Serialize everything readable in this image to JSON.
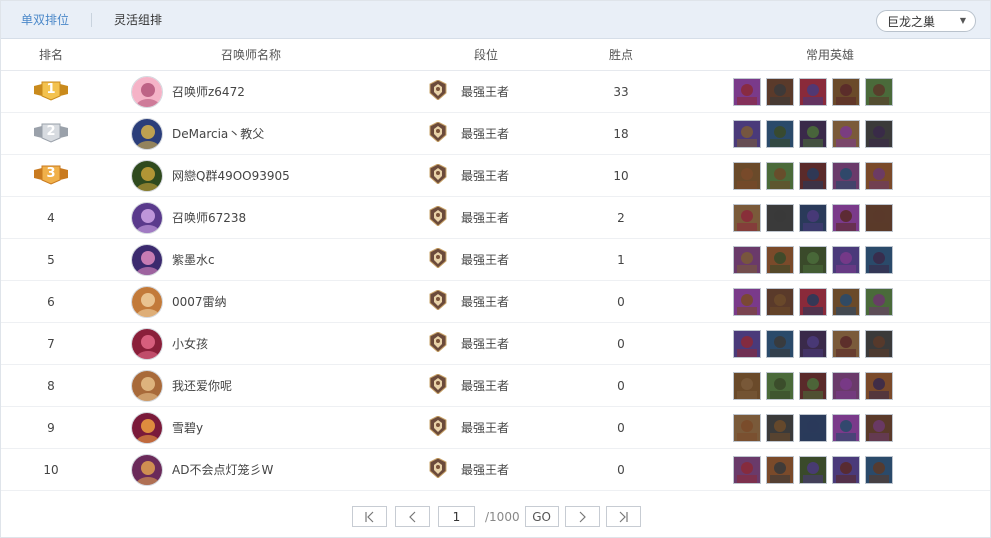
{
  "tabs": [
    {
      "label": "单双排位",
      "active": true
    },
    {
      "label": "灵活组排",
      "active": false
    }
  ],
  "server_select": {
    "value": "巨龙之巢"
  },
  "columns": {
    "rank": "排名",
    "name": "召唤师名称",
    "tier": "段位",
    "points": "胜点",
    "champions": "常用英雄"
  },
  "rows": [
    {
      "rank": "1",
      "medal": "gold",
      "name": "召唤师z6472",
      "tier": "最强王者",
      "points": "33"
    },
    {
      "rank": "2",
      "medal": "silver",
      "name": "DeMarcia丶教父",
      "tier": "最强王者",
      "points": "18"
    },
    {
      "rank": "3",
      "medal": "bronze",
      "name": "网戀Q群49OO93905",
      "tier": "最强王者",
      "points": "10"
    },
    {
      "rank": "4",
      "medal": "",
      "name": "召唤师67238",
      "tier": "最强王者",
      "points": "2"
    },
    {
      "rank": "5",
      "medal": "",
      "name": "紫墨水c",
      "tier": "最强王者",
      "points": "1"
    },
    {
      "rank": "6",
      "medal": "",
      "name": "0007雷纳",
      "tier": "最强王者",
      "points": "0"
    },
    {
      "rank": "7",
      "medal": "",
      "name": "小女孩",
      "tier": "最强王者",
      "points": "0"
    },
    {
      "rank": "8",
      "medal": "",
      "name": "我还爱你呢",
      "tier": "最强王者",
      "points": "0"
    },
    {
      "rank": "9",
      "medal": "",
      "name": "雪碧y",
      "tier": "最强王者",
      "points": "0"
    },
    {
      "rank": "10",
      "medal": "",
      "name": "AD不会点灯笼彡W",
      "tier": "最强王者",
      "points": "0"
    }
  ],
  "pagination": {
    "current_page": "1",
    "total": "/1000",
    "go_label": "GO"
  },
  "colors": {
    "tab_active": "#4b88c9",
    "tabbar_bg": "#e9eff7",
    "gold": "#e8a93a",
    "silver": "#b9bec6",
    "bronze": "#e59a3b"
  }
}
